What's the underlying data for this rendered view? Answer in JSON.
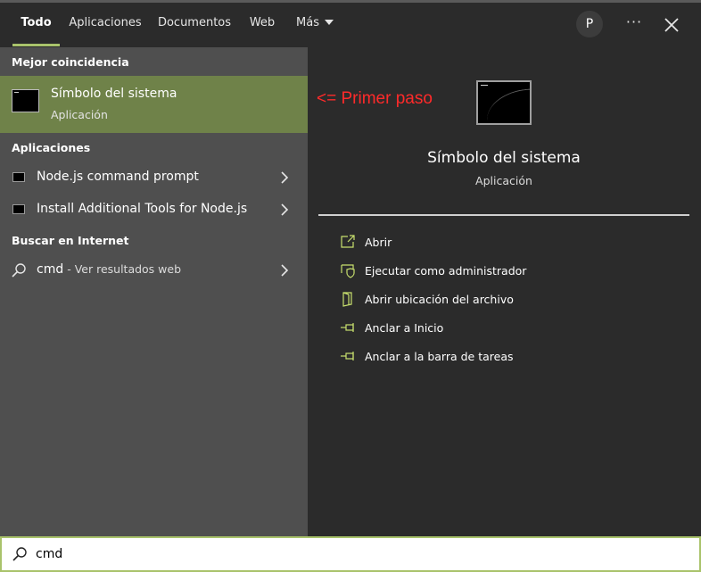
{
  "tabs": [
    {
      "label": "Todo"
    },
    {
      "label": "Aplicaciones"
    },
    {
      "label": "Documentos"
    },
    {
      "label": "Web"
    },
    {
      "label": "Más"
    }
  ],
  "header": {
    "avatar_initial": "P",
    "more_glyph": "···"
  },
  "sections": {
    "best_match": "Mejor coincidencia",
    "apps": "Aplicaciones",
    "web": "Buscar en Internet"
  },
  "best_match": {
    "title": "Símbolo del sistema",
    "subtitle": "Aplicación"
  },
  "apps": [
    {
      "label": "Node.js command prompt"
    },
    {
      "label": "Install Additional Tools for Node.js"
    }
  ],
  "web_result": {
    "query": "cmd",
    "suffix": " - Ver resultados web"
  },
  "annotation": "<= Primer paso",
  "detail": {
    "title": "Símbolo del sistema",
    "subtitle": "Aplicación",
    "actions": [
      {
        "label": "Abrir",
        "icon": "open-icon"
      },
      {
        "label": "Ejecutar como administrador",
        "icon": "shield-icon"
      },
      {
        "label": "Abrir ubicación del archivo",
        "icon": "file-location-icon"
      },
      {
        "label": "Anclar a Inicio",
        "icon": "pin-icon"
      },
      {
        "label": "Anclar a la barra de tareas",
        "icon": "pin-icon"
      }
    ]
  },
  "search": {
    "value": "cmd"
  },
  "colors": {
    "accent": "#a9c36b",
    "selection": "#6f8249",
    "annotation": "#ff2a2a"
  }
}
